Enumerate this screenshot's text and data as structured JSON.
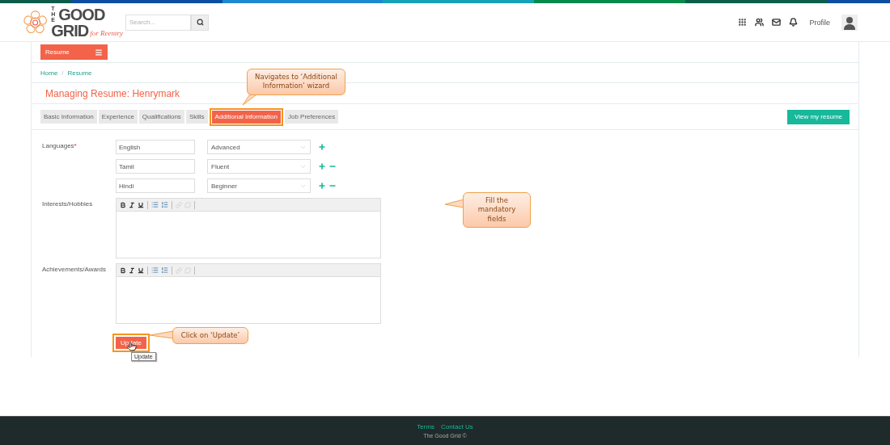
{
  "header": {
    "logo": {
      "the": "THE",
      "good": "GOOD",
      "grid": "GRID",
      "tagline": "for Reentry"
    },
    "search": {
      "placeholder": "Search..."
    },
    "profile": "Profile"
  },
  "menu": {
    "label": "Resume"
  },
  "breadcrumbs": [
    {
      "label": "Home"
    },
    {
      "label": "Resume"
    }
  ],
  "breadcrumb_separator": "/",
  "title": "Managing Resume: Henrymark",
  "tabs": [
    {
      "label": "Basic Information",
      "selected": false
    },
    {
      "label": "Experience",
      "selected": false
    },
    {
      "label": "Qualifications",
      "selected": false
    },
    {
      "label": "Skills",
      "selected": false
    },
    {
      "label": "Additional Information",
      "selected": true
    },
    {
      "label": "Job Preferences",
      "selected": false
    }
  ],
  "view_button": "View my resume",
  "languages": {
    "label": "Languages",
    "required": true,
    "required_mark": "*",
    "rows": [
      {
        "language": "English",
        "level": "Advanced",
        "removable": false
      },
      {
        "language": "Tamil",
        "level": "Fluent",
        "removable": true
      },
      {
        "language": "Hindi",
        "level": "Beginner",
        "removable": true
      }
    ]
  },
  "editors": [
    {
      "label": "Interests/Hobbies"
    },
    {
      "label": "Achievements/Awards"
    }
  ],
  "update_button": {
    "label": "Update",
    "tooltip": "Update"
  },
  "callouts": [
    {
      "text": "Navigates to ‘Additional Information’ wizard"
    },
    {
      "text": "Fill the mandatory fields"
    },
    {
      "text": "Click on ‘Update’"
    }
  ],
  "footer": {
    "links": [
      {
        "label": "Terms"
      },
      {
        "label": "Contact Us"
      }
    ],
    "copyright": "The Good Grid ©"
  }
}
